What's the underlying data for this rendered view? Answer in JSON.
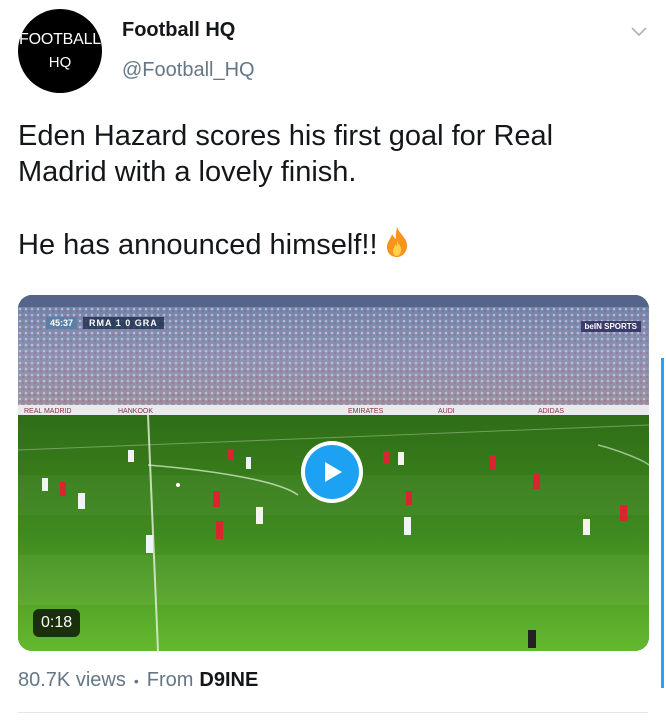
{
  "account": {
    "avatar_line1": "FOOTBALL",
    "avatar_line2": "HQ",
    "name": "Football HQ",
    "handle": "@Football_HQ"
  },
  "tweet": {
    "line1": "Eden Hazard scores his first goal for Real Madrid with a lovely finish.",
    "line2": "He has announced himself!!",
    "emoji_icon": "fire-icon"
  },
  "video": {
    "clock": "45:37",
    "score": "RMA  1  0  GRA",
    "channel": "beIN SPORTS",
    "duration": "0:18"
  },
  "stats": {
    "views": "80.7K views",
    "separator": "•",
    "from_label": "From",
    "source": "D9INE"
  },
  "colors": {
    "accent": "#1da1f2",
    "secondary_text": "#657786",
    "pitch": "#3f8a1f"
  }
}
